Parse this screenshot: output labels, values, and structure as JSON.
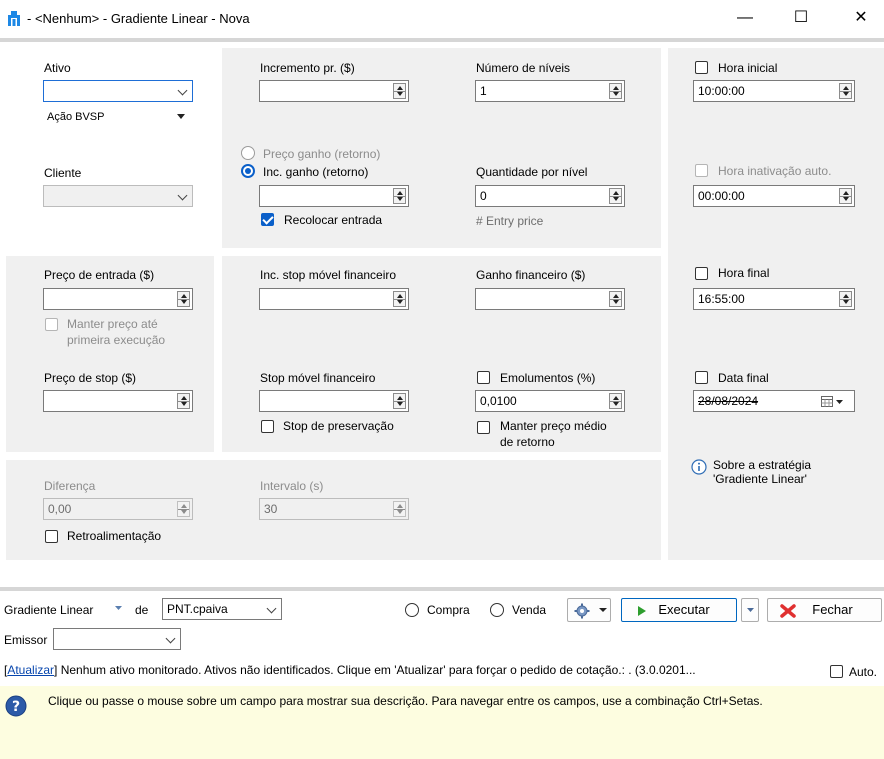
{
  "window": {
    "title": "- <Nenhum> - Gradiente Linear - Nova",
    "minimize_glyph": "—",
    "maximize_glyph": "☐",
    "close_glyph": "✕"
  },
  "ativo": {
    "label": "Ativo",
    "value": "",
    "type_value": "Ação BVSP"
  },
  "cliente": {
    "label": "Cliente",
    "value": ""
  },
  "incremento": {
    "label": "Incremento pr. ($)",
    "value": ""
  },
  "ganho_mode": {
    "option1": "Preço ganho (retorno)",
    "option2": "Inc. ganho (retorno)",
    "selected": "option2",
    "value": "",
    "recolocar_label": "Recolocar entrada",
    "recolocar_checked": true
  },
  "niveis": {
    "label": "Número de níveis",
    "value": "1"
  },
  "quantidade": {
    "label": "Quantidade por nível",
    "value": "0",
    "hint": "# Entry price"
  },
  "entrada": {
    "label": "Preço de entrada ($)",
    "value": "",
    "manter_label_line1": "Manter preço até",
    "manter_label_line2": "primeira execução"
  },
  "stop": {
    "label": "Preço de stop ($)",
    "value": ""
  },
  "inc_stop": {
    "label": "Inc. stop móvel financeiro",
    "value": ""
  },
  "stop_movel": {
    "label": "Stop móvel financeiro",
    "value": "",
    "preservacao_label": "Stop de preservação"
  },
  "ganho_fin": {
    "label": "Ganho financeiro ($)",
    "value": ""
  },
  "emolumentos": {
    "label": "Emolumentos (%)",
    "value": "0,0100",
    "manter_line1": "Manter preço médio",
    "manter_line2": "de retorno"
  },
  "diferenca": {
    "label": "Diferença",
    "value": "0,00",
    "retro_label": "Retroalimentação"
  },
  "intervalo": {
    "label": "Intervalo (s)",
    "value": "30"
  },
  "hora_inicial": {
    "label": "Hora inicial",
    "value": "10:00:00"
  },
  "hora_inativacao": {
    "label": "Hora inativação auto.",
    "value": "00:00:00"
  },
  "hora_final": {
    "label": "Hora final",
    "value": "16:55:00"
  },
  "data_final": {
    "label": "Data final",
    "value": "28/08/2024"
  },
  "sobre": {
    "line1": "Sobre a estratégia",
    "line2": "'Gradiente Linear'"
  },
  "bottom": {
    "strategy_label": "Gradiente Linear",
    "de_label": "de",
    "account_value": "PNT.cpaiva",
    "compra_label": "Compra",
    "venda_label": "Venda",
    "executar_label": "Executar",
    "fechar_label": "Fechar",
    "emissor_label": "Emissor",
    "emissor_value": ""
  },
  "status": {
    "link": "Atualizar",
    "open_bracket": "[",
    "text": "] Nenhum ativo monitorado. Ativos não identificados. Clique em 'Atualizar' para forçar o pedido de cotação.: .  (3.0.0201...",
    "auto_label": "Auto."
  },
  "help_text": "Clique ou passe o mouse sobre um campo para mostrar sua descrição. Para navegar entre os campos, use a combinação Ctrl+Setas.",
  "colors": {
    "accent": "#0a5fc9",
    "panel": "#f0f0f0",
    "help_bg": "#fdfde0",
    "fechar_icon": "#e03030",
    "executar_icon": "#2e9e2e"
  }
}
